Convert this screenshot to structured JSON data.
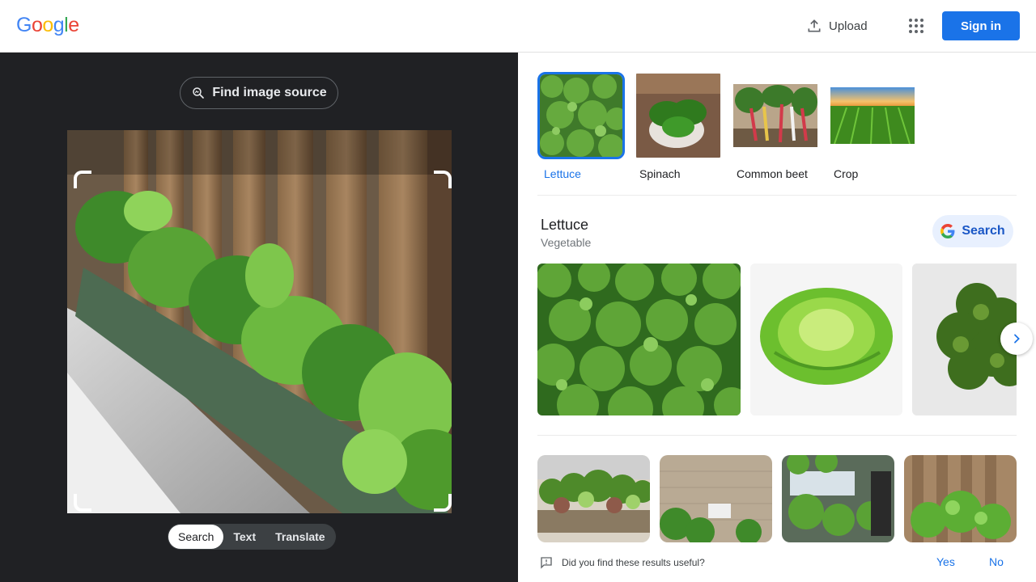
{
  "header": {
    "logo": {
      "letters": [
        {
          "char": "G",
          "color": "#4285F4"
        },
        {
          "char": "o",
          "color": "#EA4335"
        },
        {
          "char": "o",
          "color": "#FBBC05"
        },
        {
          "char": "g",
          "color": "#4285F4"
        },
        {
          "char": "l",
          "color": "#34A853"
        },
        {
          "char": "e",
          "color": "#EA4335"
        }
      ]
    },
    "upload_label": "Upload",
    "signin_label": "Sign in"
  },
  "left": {
    "find_source_label": "Find image source",
    "modes": [
      "Search",
      "Text",
      "Translate"
    ],
    "active_mode": "Search"
  },
  "right": {
    "chips": [
      {
        "label": "Lettuce",
        "selected": true
      },
      {
        "label": "Spinach",
        "selected": false
      },
      {
        "label": "Common beet",
        "selected": false
      },
      {
        "label": "Crop",
        "selected": false
      }
    ],
    "entity": {
      "title": "Lettuce",
      "subtitle": "Vegetable",
      "search_label": "Search"
    },
    "feedback": {
      "question": "Did you find these results useful?",
      "yes": "Yes",
      "no": "No"
    }
  },
  "colors": {
    "accent": "#1a73e8",
    "dark_bg": "#202124"
  }
}
